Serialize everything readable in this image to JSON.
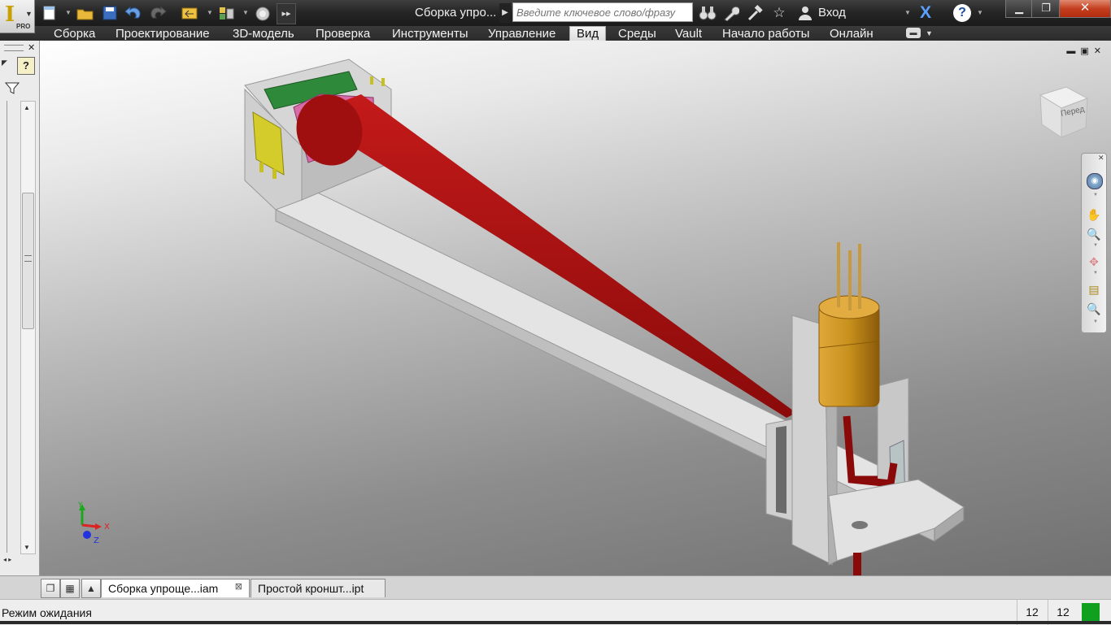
{
  "app": {
    "logo_letter": "I",
    "edition": "PRO",
    "document_title": "Сборка упро...",
    "search_placeholder": "Введите ключевое слово/фразу",
    "login_label": "Вход"
  },
  "icons": {
    "quick_access": [
      "new-icon",
      "open-icon",
      "save-icon",
      "undo-icon",
      "redo-icon",
      "return-icon",
      "bom-icon",
      "appearance-icon",
      "more-icon"
    ],
    "header": [
      "binoculars-icon",
      "wrench-icon",
      "hammer-icon",
      "star-icon",
      "user-icon",
      "exchange-icon",
      "help-icon"
    ],
    "navbar": [
      "steering-wheel-icon",
      "pan-icon",
      "zoom-icon",
      "orbit-icon",
      "look-at-icon",
      "zoom-window-icon"
    ]
  },
  "ribbon": {
    "tabs": [
      "Сборка",
      "Проектирование",
      "3D-модель",
      "Проверка",
      "Инструменты",
      "Управление",
      "Вид",
      "Среды",
      "Vault",
      "Начало работы",
      "Онлайн"
    ],
    "active_tab": "Вид"
  },
  "viewport": {
    "viewcube_face": "Перед",
    "triad": {
      "x": "X",
      "y": "Y",
      "z": "Z"
    }
  },
  "document_tabs": [
    {
      "label": "Сборка упроще...iam",
      "active": true
    },
    {
      "label": "Простой кроншт...ipt",
      "active": false
    }
  ],
  "status": {
    "text": "Режим ожидания",
    "count_1": "12",
    "count_2": "12"
  },
  "colors": {
    "beam": "#8a0a0a",
    "base_plate": "#d8d8d8",
    "laser_body": "#c8901c",
    "pcb": "#2e8a3a",
    "prism": "#d86aa8",
    "connector": "#d4cc2a",
    "status_ok": "#10a020"
  }
}
